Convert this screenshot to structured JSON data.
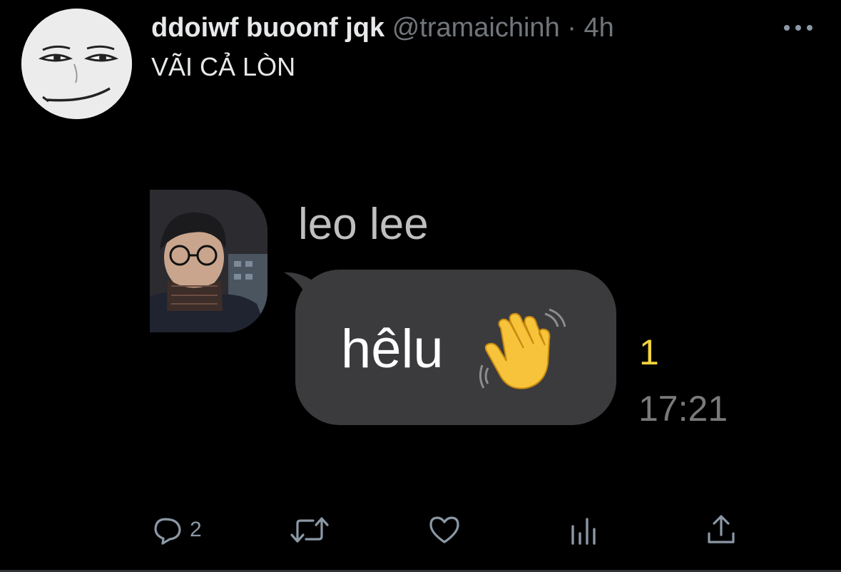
{
  "tweet": {
    "display_name": "ddoiwf buoonf jqk",
    "handle": "@tramaichinh",
    "separator": "·",
    "time": "4h",
    "text": "VÃI CẢ LÒN"
  },
  "attachment": {
    "sender_name": "leo lee",
    "message_text": "hêlu",
    "emoji": "waving-hand",
    "unread_count": "1",
    "message_time": "17:21"
  },
  "actions": {
    "reply_count": "2",
    "retweet_count": "",
    "like_count": "",
    "views_count": ""
  },
  "colors": {
    "background": "#000000",
    "secondary_text": "#71767b",
    "bubble": "#3b3b3d",
    "unread_badge": "#f2d33d"
  }
}
